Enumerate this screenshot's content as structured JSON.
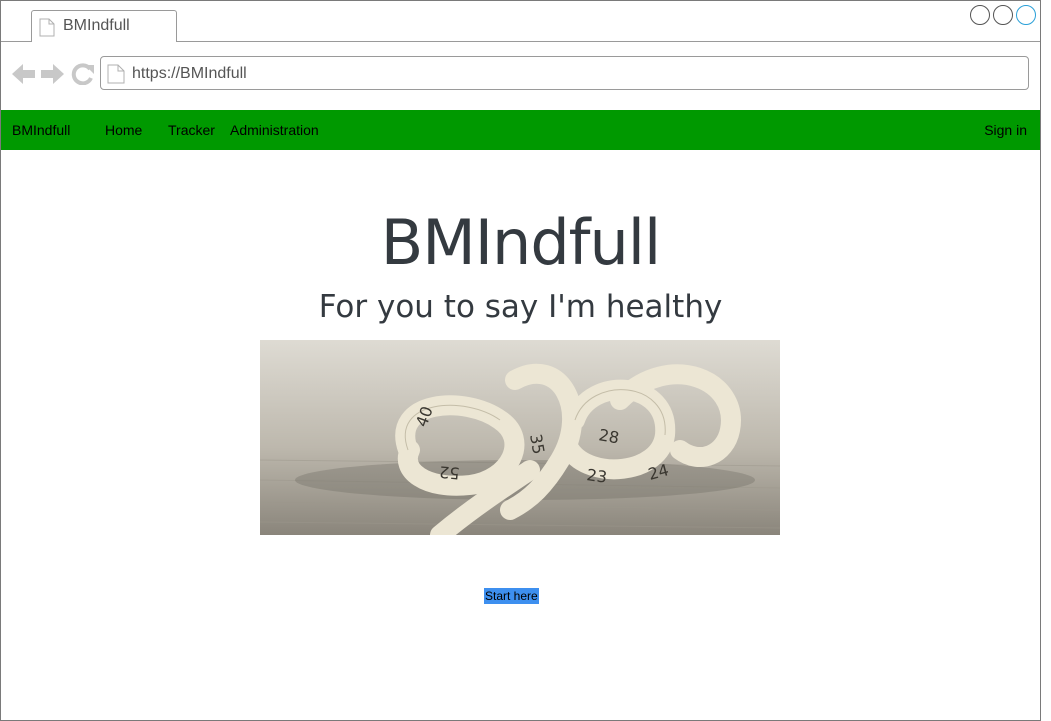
{
  "browser": {
    "tab_title": "BMIndfull",
    "url": "https://BMIndfull"
  },
  "navbar": {
    "brand": "BMIndfull",
    "links": [
      "Home",
      "Tracker",
      "Administration"
    ],
    "signin": "Sign in",
    "color": "#009900"
  },
  "hero": {
    "title": "BMIndfull",
    "subtitle": "For you to say I'm healthy",
    "image_tape_numbers": [
      "40",
      "35",
      "28",
      "52",
      "23",
      "24"
    ],
    "cta": "Start here",
    "cta_color": "#3d8fef"
  }
}
